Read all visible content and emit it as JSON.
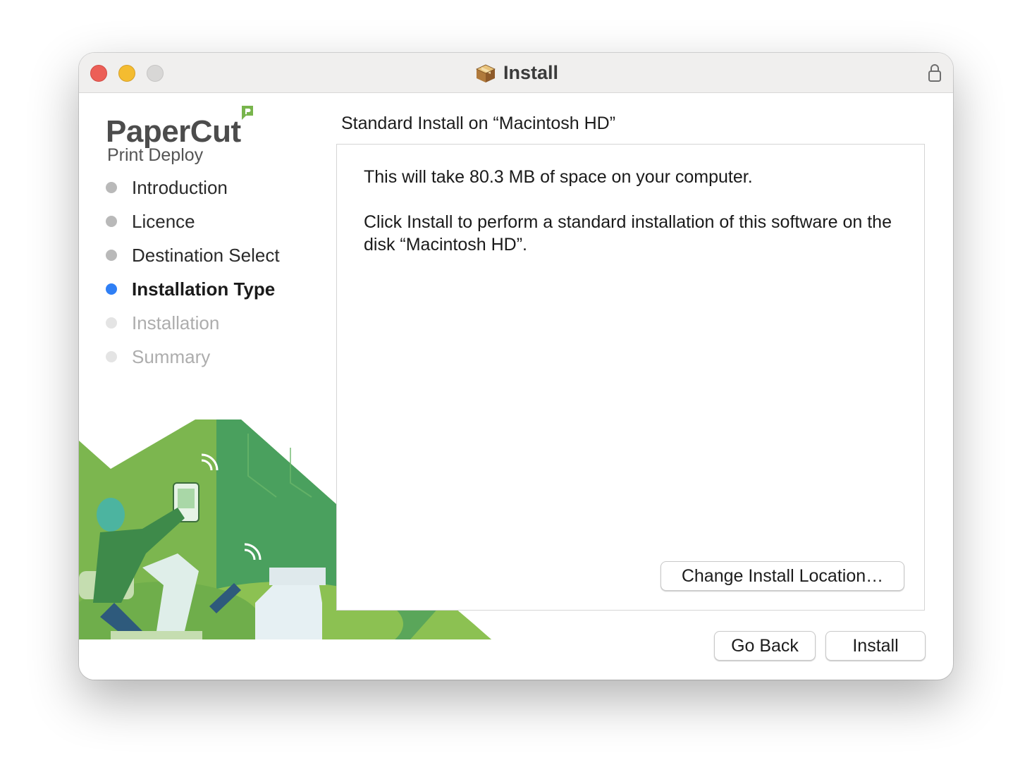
{
  "window": {
    "title": "Install",
    "title_icon": "package-icon",
    "lock_icon": "lock-icon"
  },
  "sidebar": {
    "logo": {
      "brand": "PaperCut",
      "product": "Print Deploy"
    },
    "steps": [
      {
        "label": "Introduction",
        "state": "done"
      },
      {
        "label": "Licence",
        "state": "done"
      },
      {
        "label": "Destination Select",
        "state": "done"
      },
      {
        "label": "Installation Type",
        "state": "current"
      },
      {
        "label": "Installation",
        "state": "pending"
      },
      {
        "label": "Summary",
        "state": "pending"
      }
    ]
  },
  "main": {
    "heading": "Standard Install on “Macintosh HD”",
    "space_text": "This will take 80.3 MB of space on your computer.",
    "instruction_text": "Click Install to perform a standard installation of this software on the disk “Macintosh HD”.",
    "change_location_label": "Change Install Location…"
  },
  "footer": {
    "back_label": "Go Back",
    "install_label": "Install"
  },
  "colors": {
    "accent": "#2f7ff5",
    "close": "#ec5f57",
    "minimize": "#f4bc30",
    "zoom_disabled": "#d8d7d6",
    "brand_green": "#78b54c"
  }
}
